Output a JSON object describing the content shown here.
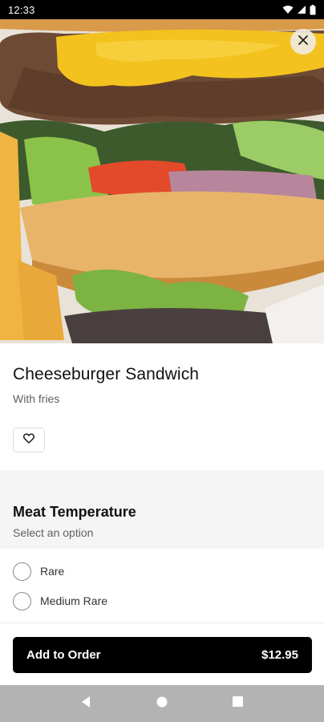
{
  "status_bar": {
    "time": "12:33",
    "icons": [
      "wifi-icon",
      "cell-signal-icon",
      "battery-icon"
    ]
  },
  "hero": {
    "image_subject": "cheeseburger with fries"
  },
  "item": {
    "title": "Cheeseburger Sandwich",
    "subtitle": "With fries",
    "favorite_icon": "heart-icon"
  },
  "modifier_group": {
    "title": "Meat Temperature",
    "subtitle": "Select an option",
    "options": [
      {
        "label": "Rare",
        "selected": false
      },
      {
        "label": "Medium Rare",
        "selected": false
      }
    ]
  },
  "order_button": {
    "label": "Add to Order",
    "price": "$12.95"
  },
  "nav_bar": {
    "icons": [
      "back-icon",
      "home-icon",
      "recents-icon"
    ]
  },
  "colors": {
    "primary_button": "#000000",
    "section_background": "#f5f5f5",
    "nav_bar": "#b3b3b3"
  }
}
